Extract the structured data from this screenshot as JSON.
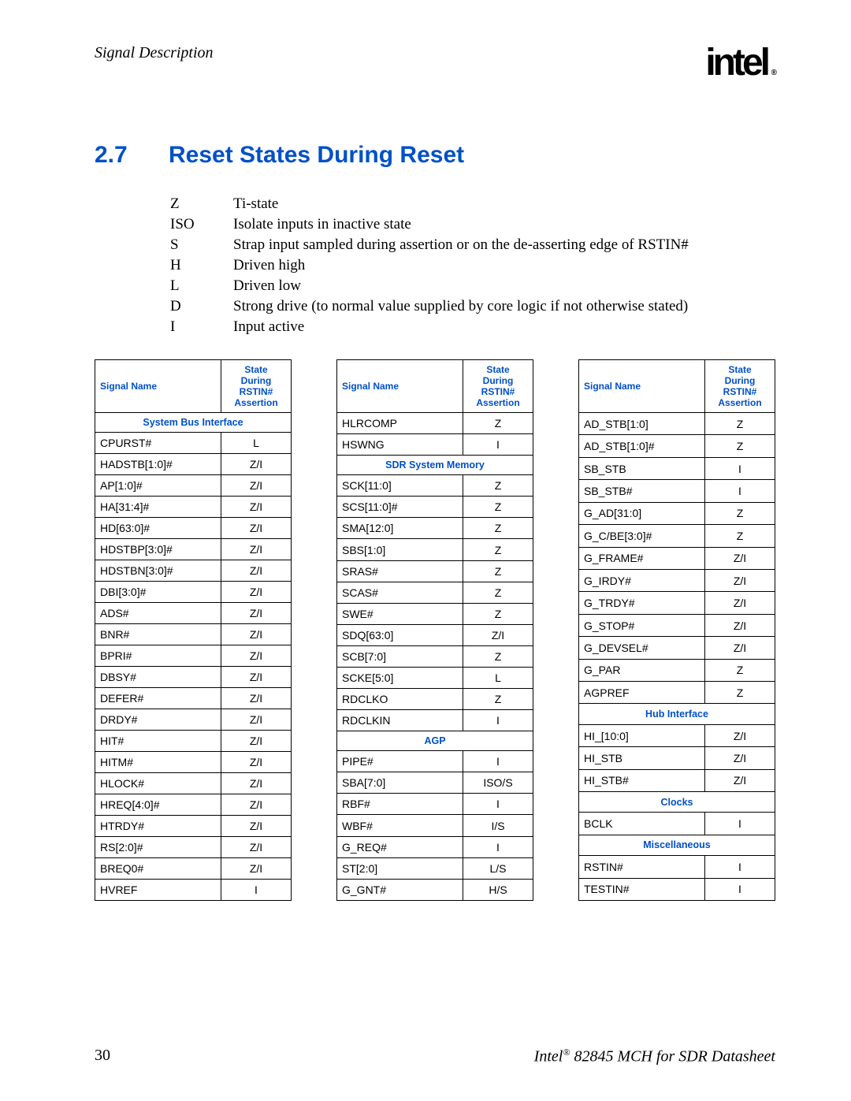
{
  "chapter_label": "Signal Description",
  "logo_text": "intel",
  "logo_reg": "®",
  "section": {
    "num": "2.7",
    "title": "Reset States During Reset"
  },
  "legend": [
    {
      "key": "Z",
      "desc": "Ti-state"
    },
    {
      "key": "ISO",
      "desc": "Isolate inputs in inactive state"
    },
    {
      "key": "S",
      "desc": "Strap input sampled during assertion or on the de-asserting edge of RSTIN#"
    },
    {
      "key": "H",
      "desc": "Driven high"
    },
    {
      "key": "L",
      "desc": "Driven low"
    },
    {
      "key": "D",
      "desc": "Strong drive (to normal value supplied by core logic if not otherwise stated)"
    },
    {
      "key": "I",
      "desc": "Input active"
    }
  ],
  "columns": {
    "name": "Signal Name",
    "state": "State During RSTIN# Assertion"
  },
  "tables": [
    [
      {
        "type": "group",
        "label": "System Bus Interface"
      },
      {
        "name": "CPURST#",
        "state": "L"
      },
      {
        "name": "HADSTB[1:0]#",
        "state": "Z/I"
      },
      {
        "name": "AP[1:0]#",
        "state": "Z/I"
      },
      {
        "name": "HA[31:4]#",
        "state": "Z/I"
      },
      {
        "name": "HD[63:0]#",
        "state": "Z/I"
      },
      {
        "name": "HDSTBP[3:0]#",
        "state": "Z/I"
      },
      {
        "name": "HDSTBN[3:0]#",
        "state": "Z/I"
      },
      {
        "name": "DBI[3:0]#",
        "state": "Z/I"
      },
      {
        "name": "ADS#",
        "state": "Z/I"
      },
      {
        "name": "BNR#",
        "state": "Z/I"
      },
      {
        "name": "BPRI#",
        "state": "Z/I"
      },
      {
        "name": "DBSY#",
        "state": "Z/I"
      },
      {
        "name": "DEFER#",
        "state": "Z/I"
      },
      {
        "name": "DRDY#",
        "state": "Z/I"
      },
      {
        "name": "HIT#",
        "state": "Z/I"
      },
      {
        "name": "HITM#",
        "state": "Z/I"
      },
      {
        "name": "HLOCK#",
        "state": "Z/I"
      },
      {
        "name": "HREQ[4:0]#",
        "state": "Z/I"
      },
      {
        "name": "HTRDY#",
        "state": "Z/I"
      },
      {
        "name": "RS[2:0]#",
        "state": "Z/I"
      },
      {
        "name": "BREQ0#",
        "state": "Z/I"
      },
      {
        "name": "HVREF",
        "state": "I"
      }
    ],
    [
      {
        "name": "HLRCOMP",
        "state": "Z"
      },
      {
        "name": "HSWNG",
        "state": "I"
      },
      {
        "type": "group",
        "label": "SDR System Memory"
      },
      {
        "name": "SCK[11:0]",
        "state": "Z"
      },
      {
        "name": "SCS[11:0]#",
        "state": "Z"
      },
      {
        "name": "SMA[12:0]",
        "state": "Z"
      },
      {
        "name": "SBS[1:0]",
        "state": "Z"
      },
      {
        "name": "SRAS#",
        "state": "Z"
      },
      {
        "name": "SCAS#",
        "state": "Z"
      },
      {
        "name": "SWE#",
        "state": "Z"
      },
      {
        "name": "SDQ[63:0]",
        "state": "Z/I"
      },
      {
        "name": "SCB[7:0]",
        "state": "Z"
      },
      {
        "name": "SCKE[5:0]",
        "state": "L"
      },
      {
        "name": "RDCLKO",
        "state": "Z"
      },
      {
        "name": "RDCLKIN",
        "state": "I"
      },
      {
        "type": "group",
        "label": "AGP"
      },
      {
        "name": "PIPE#",
        "state": "I"
      },
      {
        "name": "SBA[7:0]",
        "state": "ISO/S"
      },
      {
        "name": "RBF#",
        "state": "I"
      },
      {
        "name": "WBF#",
        "state": "I/S"
      },
      {
        "name": "G_REQ#",
        "state": "I"
      },
      {
        "name": "ST[2:0]",
        "state": "L/S"
      },
      {
        "name": "G_GNT#",
        "state": "H/S"
      }
    ],
    [
      {
        "name": "AD_STB[1:0]",
        "state": "Z"
      },
      {
        "name": "AD_STB[1:0]#",
        "state": "Z"
      },
      {
        "name": "SB_STB",
        "state": "I"
      },
      {
        "name": "SB_STB#",
        "state": "I"
      },
      {
        "name": "G_AD[31:0]",
        "state": "Z"
      },
      {
        "name": "G_C/BE[3:0]#",
        "state": "Z"
      },
      {
        "name": "G_FRAME#",
        "state": "Z/I"
      },
      {
        "name": "G_IRDY#",
        "state": "Z/I"
      },
      {
        "name": "G_TRDY#",
        "state": "Z/I"
      },
      {
        "name": "G_STOP#",
        "state": "Z/I"
      },
      {
        "name": "G_DEVSEL#",
        "state": "Z/I"
      },
      {
        "name": "G_PAR",
        "state": "Z"
      },
      {
        "name": "AGPREF",
        "state": "Z"
      },
      {
        "type": "group",
        "label": "Hub Interface"
      },
      {
        "name": "HI_[10:0]",
        "state": "Z/I"
      },
      {
        "name": "HI_STB",
        "state": "Z/I"
      },
      {
        "name": "HI_STB#",
        "state": "Z/I"
      },
      {
        "type": "group",
        "label": "Clocks"
      },
      {
        "name": "BCLK",
        "state": "I"
      },
      {
        "type": "group",
        "label": "Miscellaneous"
      },
      {
        "name": "RSTIN#",
        "state": "I"
      },
      {
        "name": "TESTIN#",
        "state": "I"
      }
    ]
  ],
  "footer": {
    "page_num": "30",
    "doc_title_a": "Intel",
    "doc_title_sup": "®",
    "doc_title_b": " 82845 MCH for SDR Datasheet"
  }
}
